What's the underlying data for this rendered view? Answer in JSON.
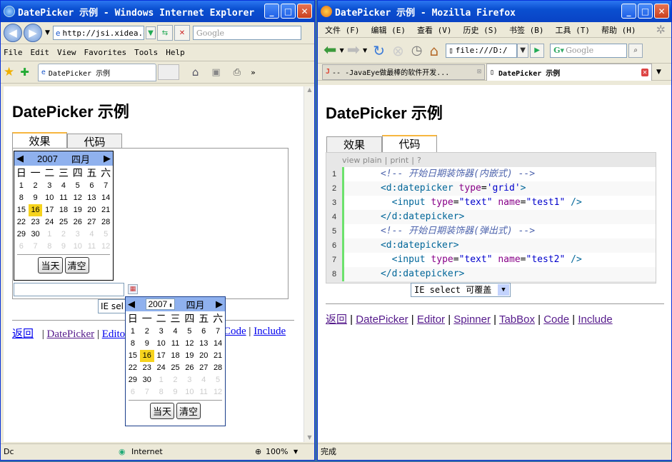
{
  "ie": {
    "title": "DatePicker 示例 - Windows Internet Explorer",
    "address": "http://jsi.xidea.o",
    "search_placeholder": "Google",
    "menu": [
      "File",
      "Edit",
      "View",
      "Favorites",
      "Tools",
      "Help"
    ],
    "tab_label": "DatePicker 示例",
    "page_title": "DatePicker 示例",
    "tabs": [
      "效果",
      "代码"
    ],
    "inline_calendar": {
      "year": "2007",
      "month": "四月",
      "weekdays": [
        "日",
        "一",
        "二",
        "三",
        "四",
        "五",
        "六"
      ],
      "days": [
        "1",
        "2",
        "3",
        "4",
        "5",
        "6",
        "7",
        "8",
        "9",
        "10",
        "11",
        "12",
        "13",
        "14",
        "15",
        "16",
        "17",
        "18",
        "19",
        "20",
        "21",
        "22",
        "23",
        "24",
        "25",
        "26",
        "27",
        "28",
        "29",
        "30",
        "1",
        "2",
        "3",
        "4",
        "5",
        "6",
        "7",
        "8",
        "9",
        "10",
        "11",
        "12"
      ],
      "today_label": "当天",
      "clear_label": "清空"
    },
    "popup_calendar": {
      "year": "2007",
      "month": "四月",
      "weekdays": [
        "日",
        "一",
        "二",
        "三",
        "四",
        "五",
        "六"
      ],
      "days": [
        "1",
        "2",
        "3",
        "4",
        "5",
        "6",
        "7",
        "8",
        "9",
        "10",
        "11",
        "12",
        "13",
        "14",
        "15",
        "16",
        "17",
        "18",
        "19",
        "20",
        "21",
        "22",
        "23",
        "24",
        "25",
        "26",
        "27",
        "28",
        "29",
        "30",
        "1",
        "2",
        "3",
        "4",
        "5",
        "6",
        "7",
        "8",
        "9",
        "10",
        "11",
        "12"
      ],
      "today_label": "当天",
      "clear_label": "清空"
    },
    "select_label": "IE sel",
    "links": [
      "返回",
      "DatePicker",
      "Edito",
      "Code",
      "Include"
    ],
    "status_left": "Dc",
    "status_zone": "Internet",
    "zoom": "100%"
  },
  "ff": {
    "title": "DatePicker 示例 - Mozilla Firefox",
    "menu": [
      "文件 (F)",
      "编辑 (E)",
      "查看 (V)",
      "历史 (S)",
      "书签 (B)",
      "工具 (T)",
      "帮助 (H)"
    ],
    "address": "file:///D:/",
    "search_placeholder": "Google",
    "tabs": [
      "-- -JavaEye做最棒的软件开发...",
      "DatePicker 示例"
    ],
    "page_title": "DatePicker 示例",
    "content_tabs": [
      "效果",
      "代码"
    ],
    "code_tools": [
      "view plain",
      "print",
      "?"
    ],
    "code_lines": [
      {
        "num": "1",
        "parts": [
          {
            "t": "      ",
            "c": ""
          },
          {
            "t": "<!-- 开始日期装饰器(内嵌式) -->",
            "c": "cmt"
          }
        ]
      },
      {
        "num": "2",
        "parts": [
          {
            "t": "      ",
            "c": ""
          },
          {
            "t": "<d:datepicker ",
            "c": "tagc"
          },
          {
            "t": "type",
            "c": "attr"
          },
          {
            "t": "=",
            "c": ""
          },
          {
            "t": "'grid'",
            "c": "str"
          },
          {
            "t": ">",
            "c": "tagc"
          }
        ]
      },
      {
        "num": "3",
        "parts": [
          {
            "t": "        ",
            "c": ""
          },
          {
            "t": "<input ",
            "c": "tagc"
          },
          {
            "t": "type",
            "c": "attr"
          },
          {
            "t": "=",
            "c": ""
          },
          {
            "t": "\"text\" ",
            "c": "str"
          },
          {
            "t": "name",
            "c": "attr"
          },
          {
            "t": "=",
            "c": ""
          },
          {
            "t": "\"test1\" ",
            "c": "str"
          },
          {
            "t": "/>",
            "c": "tagc"
          }
        ]
      },
      {
        "num": "4",
        "parts": [
          {
            "t": "      ",
            "c": ""
          },
          {
            "t": "</d:datepicker>",
            "c": "tagc"
          }
        ]
      },
      {
        "num": "5",
        "parts": [
          {
            "t": "      ",
            "c": ""
          },
          {
            "t": "<!-- 开始日期装饰器(弹出式) -->",
            "c": "cmt"
          }
        ]
      },
      {
        "num": "6",
        "parts": [
          {
            "t": "      ",
            "c": ""
          },
          {
            "t": "<d:datepicker>",
            "c": "tagc"
          }
        ]
      },
      {
        "num": "7",
        "parts": [
          {
            "t": "        ",
            "c": ""
          },
          {
            "t": "<input ",
            "c": "tagc"
          },
          {
            "t": "type",
            "c": "attr"
          },
          {
            "t": "=",
            "c": ""
          },
          {
            "t": "\"text\" ",
            "c": "str"
          },
          {
            "t": "name",
            "c": "attr"
          },
          {
            "t": "=",
            "c": ""
          },
          {
            "t": "\"test2\" ",
            "c": "str"
          },
          {
            "t": "/>",
            "c": "tagc"
          }
        ]
      },
      {
        "num": "8",
        "parts": [
          {
            "t": "      ",
            "c": ""
          },
          {
            "t": "</d:datepicker>",
            "c": "tagc"
          }
        ]
      }
    ],
    "select_label": "IE select 可覆盖",
    "links": [
      "返回",
      "DatePicker",
      "Editor",
      "Spinner",
      "TabBox",
      "Code",
      "Include"
    ],
    "status": "完成"
  }
}
